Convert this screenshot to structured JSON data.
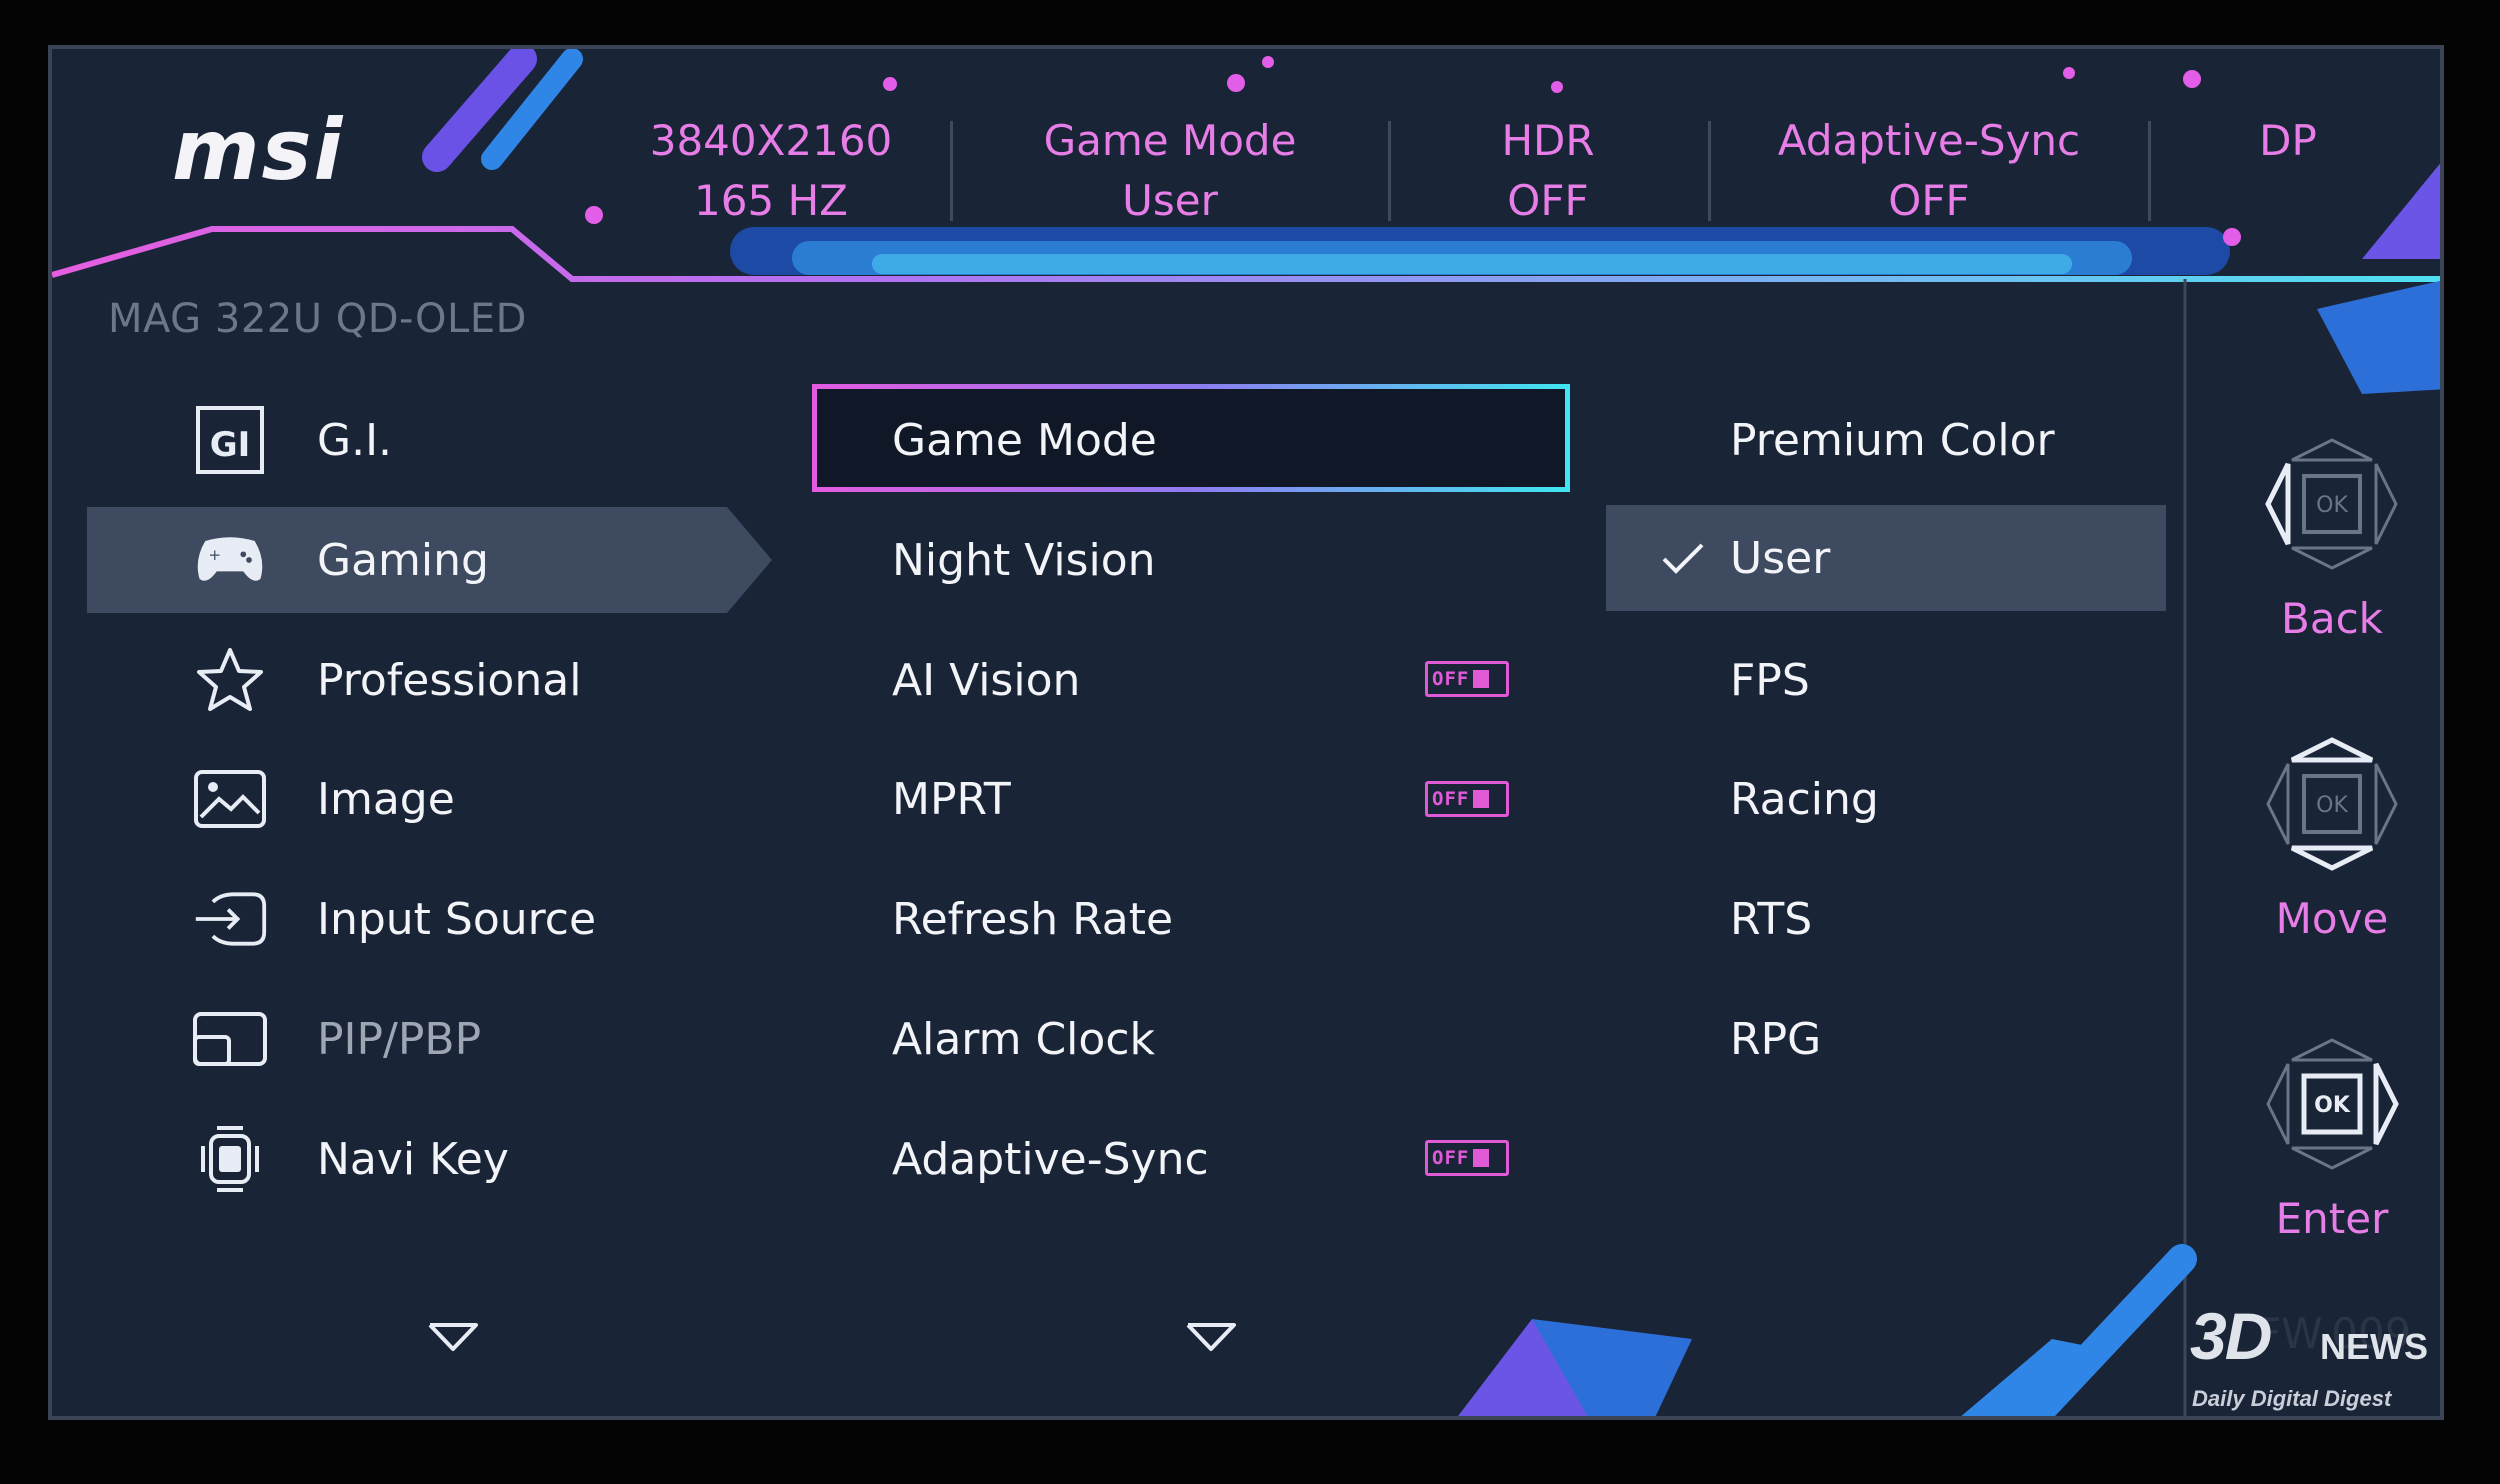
{
  "brand": "msi",
  "model": "MAG 322U QD-OLED",
  "status_bar": [
    {
      "line1": "3840X2160",
      "line2": "165 HZ"
    },
    {
      "line1": "Game Mode",
      "line2": "User"
    },
    {
      "line1": "HDR",
      "line2": "OFF"
    },
    {
      "line1": "Adaptive-Sync",
      "line2": "OFF"
    },
    {
      "line1": "DP",
      "line2": ""
    }
  ],
  "main_menu": [
    {
      "label": "G.I.",
      "icon": "gi-icon"
    },
    {
      "label": "Gaming",
      "icon": "gamepad-icon",
      "selected": true
    },
    {
      "label": "Professional",
      "icon": "star-icon"
    },
    {
      "label": "Image",
      "icon": "image-icon"
    },
    {
      "label": "Input Source",
      "icon": "input-source-icon"
    },
    {
      "label": "PIP/PBP",
      "icon": "pip-icon",
      "disabled": true
    },
    {
      "label": "Navi Key",
      "icon": "navi-key-icon"
    }
  ],
  "sub_menu": [
    {
      "label": "Game Mode",
      "focused": true
    },
    {
      "label": "Night Vision"
    },
    {
      "label": "AI Vision",
      "toggle": "OFF"
    },
    {
      "label": "MPRT",
      "toggle": "OFF"
    },
    {
      "label": "Refresh Rate"
    },
    {
      "label": "Alarm Clock"
    },
    {
      "label": "Adaptive-Sync",
      "toggle": "OFF"
    }
  ],
  "options": [
    {
      "label": "Premium Color"
    },
    {
      "label": "User",
      "checked": true
    },
    {
      "label": "FPS"
    },
    {
      "label": "Racing"
    },
    {
      "label": "RTS"
    },
    {
      "label": "RPG"
    }
  ],
  "nav_hints": {
    "back": "Back",
    "move": "Move",
    "enter": "Enter",
    "ok_label": "OK"
  },
  "firmware": "FW.009",
  "watermark": {
    "brand": "3D",
    "news": "NEWS",
    "tagline": "Daily Digital Digest"
  },
  "colors": {
    "accent_pink": "#e77de6",
    "accent_cyan": "#3fe6f0",
    "panel_bg": "#1a2437",
    "selection_bg": "#3d4a60"
  }
}
